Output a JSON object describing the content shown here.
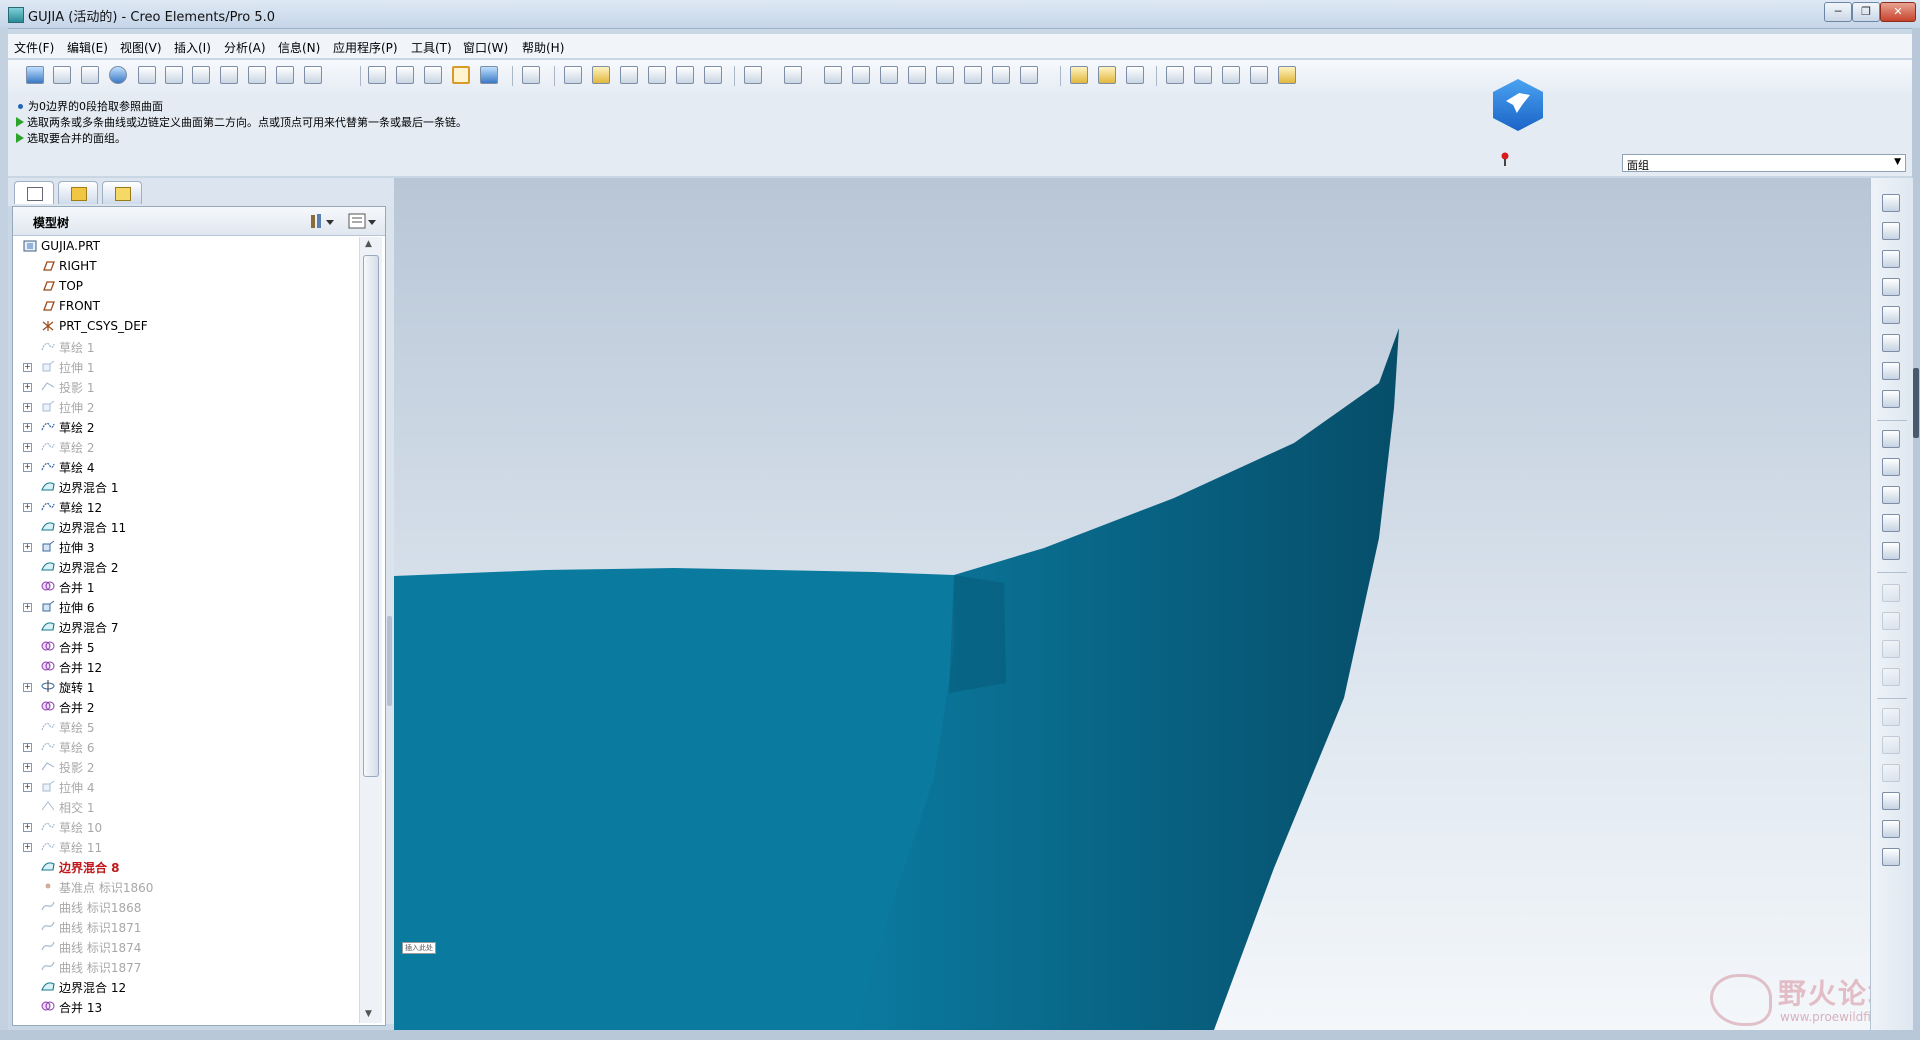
{
  "window": {
    "title": "GUJIA (活动的) - Creo Elements/Pro 5.0",
    "minimize_label": "─",
    "maximize_label": "❐",
    "close_label": "✕"
  },
  "menu": {
    "items": [
      "文件(F)",
      "编辑(E)",
      "视图(V)",
      "插入(I)",
      "分析(A)",
      "信息(N)",
      "应用程序(P)",
      "工具(T)",
      "窗口(W)",
      "帮助(H)"
    ]
  },
  "messages": [
    "为0边界的0段拾取参照曲面",
    "选取两条或多条曲线或边链定义曲面第二方向。点或顶点可用来代替第一条或最后一条链。",
    "选取要合并的面组。"
  ],
  "filter": {
    "value": "面组",
    "arrow": "▼"
  },
  "tree": {
    "title": "模型树",
    "root": "GUJIA.PRT",
    "items": [
      {
        "label": "RIGHT",
        "icon": "datum-plane-icon",
        "state": "normal",
        "expandable": false
      },
      {
        "label": "TOP",
        "icon": "datum-plane-icon",
        "state": "normal",
        "expandable": false
      },
      {
        "label": "FRONT",
        "icon": "datum-plane-icon",
        "state": "normal",
        "expandable": false
      },
      {
        "label": "PRT_CSYS_DEF",
        "icon": "csys-icon",
        "state": "normal",
        "expandable": false
      },
      {
        "label": "草绘 1",
        "icon": "sketch-icon",
        "state": "dim",
        "expandable": false
      },
      {
        "label": "拉伸 1",
        "icon": "extrude-icon",
        "state": "dim",
        "expandable": true
      },
      {
        "label": "投影 1",
        "icon": "projection-icon",
        "state": "dim",
        "expandable": true
      },
      {
        "label": "拉伸 2",
        "icon": "extrude-icon",
        "state": "dim",
        "expandable": true
      },
      {
        "label": "草绘 2",
        "icon": "sketch-icon",
        "state": "normal",
        "expandable": true
      },
      {
        "label": "草绘 2",
        "icon": "sketch-icon",
        "state": "dim",
        "expandable": true
      },
      {
        "label": "草绘 4",
        "icon": "sketch-icon",
        "state": "normal",
        "expandable": true
      },
      {
        "label": "边界混合 1",
        "icon": "boundary-blend-icon",
        "state": "normal",
        "expandable": false
      },
      {
        "label": "草绘 12",
        "icon": "sketch-icon",
        "state": "normal",
        "expandable": true
      },
      {
        "label": "边界混合 11",
        "icon": "boundary-blend-icon",
        "state": "normal",
        "expandable": false
      },
      {
        "label": "拉伸 3",
        "icon": "extrude-icon",
        "state": "normal",
        "expandable": true
      },
      {
        "label": "边界混合 2",
        "icon": "boundary-blend-icon",
        "state": "normal",
        "expandable": false
      },
      {
        "label": "合并 1",
        "icon": "merge-icon",
        "state": "normal",
        "expandable": false
      },
      {
        "label": "拉伸 6",
        "icon": "extrude-icon",
        "state": "normal",
        "expandable": true
      },
      {
        "label": "边界混合 7",
        "icon": "boundary-blend-icon",
        "state": "normal",
        "expandable": false
      },
      {
        "label": "合并 5",
        "icon": "merge-icon",
        "state": "normal",
        "expandable": false
      },
      {
        "label": "合并 12",
        "icon": "merge-icon",
        "state": "normal",
        "expandable": false
      },
      {
        "label": "旋转 1",
        "icon": "revolve-icon",
        "state": "normal",
        "expandable": true
      },
      {
        "label": "合并 2",
        "icon": "merge-icon",
        "state": "normal",
        "expandable": false
      },
      {
        "label": "草绘 5",
        "icon": "sketch-icon",
        "state": "dim",
        "expandable": false
      },
      {
        "label": "草绘 6",
        "icon": "sketch-icon",
        "state": "dim",
        "expandable": true
      },
      {
        "label": "投影 2",
        "icon": "projection-icon",
        "state": "dim",
        "expandable": true
      },
      {
        "label": "拉伸 4",
        "icon": "extrude-icon",
        "state": "dim",
        "expandable": true
      },
      {
        "label": "相交 1",
        "icon": "intersect-icon",
        "state": "dim",
        "expandable": false
      },
      {
        "label": "草绘 10",
        "icon": "sketch-icon",
        "state": "dim",
        "expandable": true
      },
      {
        "label": "草绘 11",
        "icon": "sketch-icon",
        "state": "dim",
        "expandable": true
      },
      {
        "label": "边界混合 8",
        "icon": "boundary-blend-icon",
        "state": "active",
        "expandable": false
      },
      {
        "label": "基准点 标识1860",
        "icon": "datum-point-icon",
        "state": "dim",
        "expandable": false
      },
      {
        "label": "曲线 标识1868",
        "icon": "curve-icon",
        "state": "dim",
        "expandable": false
      },
      {
        "label": "曲线 标识1871",
        "icon": "curve-icon",
        "state": "dim",
        "expandable": false
      },
      {
        "label": "曲线 标识1874",
        "icon": "curve-icon",
        "state": "dim",
        "expandable": false
      },
      {
        "label": "曲线 标识1877",
        "icon": "curve-icon",
        "state": "dim",
        "expandable": false
      },
      {
        "label": "边界混合 12",
        "icon": "boundary-blend-icon",
        "state": "normal",
        "expandable": false
      },
      {
        "label": "合并 13",
        "icon": "merge-icon",
        "state": "normal",
        "expandable": false
      }
    ]
  },
  "graphics": {
    "model_color": "#0b7a9f",
    "model_dark_color": "#064e6a",
    "tiny_label": "插入此处"
  },
  "watermark": {
    "text": "野火论坛",
    "url": "www.proewildfire.cn"
  }
}
